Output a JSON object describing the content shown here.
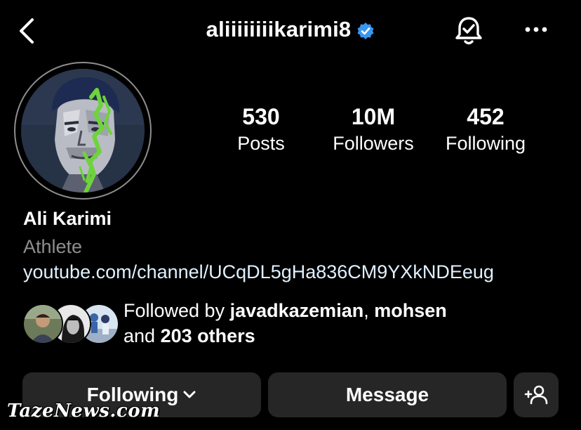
{
  "header": {
    "username": "aliiiiiiiikarimi8",
    "back_icon": "chevron-left-icon",
    "verified_icon": "verified-badge-icon",
    "bell_icon": "bell-check-icon",
    "more_icon": "more-horizontal-icon"
  },
  "stats": [
    {
      "value": "530",
      "label": "Posts"
    },
    {
      "value": "10M",
      "label": "Followers"
    },
    {
      "value": "452",
      "label": "Following"
    }
  ],
  "bio": {
    "name": "Ali Karimi",
    "category": "Athlete",
    "link": "youtube.com/channel/UCqDL5gHa836CM9YXkNDEeug"
  },
  "followed_by": {
    "prefix": "Followed by",
    "user1": "javadkazemian",
    "separator": ",",
    "user2": "mohsen",
    "and_text": "and",
    "others": "203 others"
  },
  "actions": {
    "following_label": "Following",
    "message_label": "Message",
    "add_person_icon": "add-person-icon"
  },
  "watermark": "TazeNews.com",
  "colors": {
    "background": "#000000",
    "button_bg": "#262626",
    "verified_blue": "#3897f0",
    "secondary_text": "#8e8e8e",
    "link_text": "#e0f1ff",
    "avatar_accent": "#6ed33c"
  }
}
